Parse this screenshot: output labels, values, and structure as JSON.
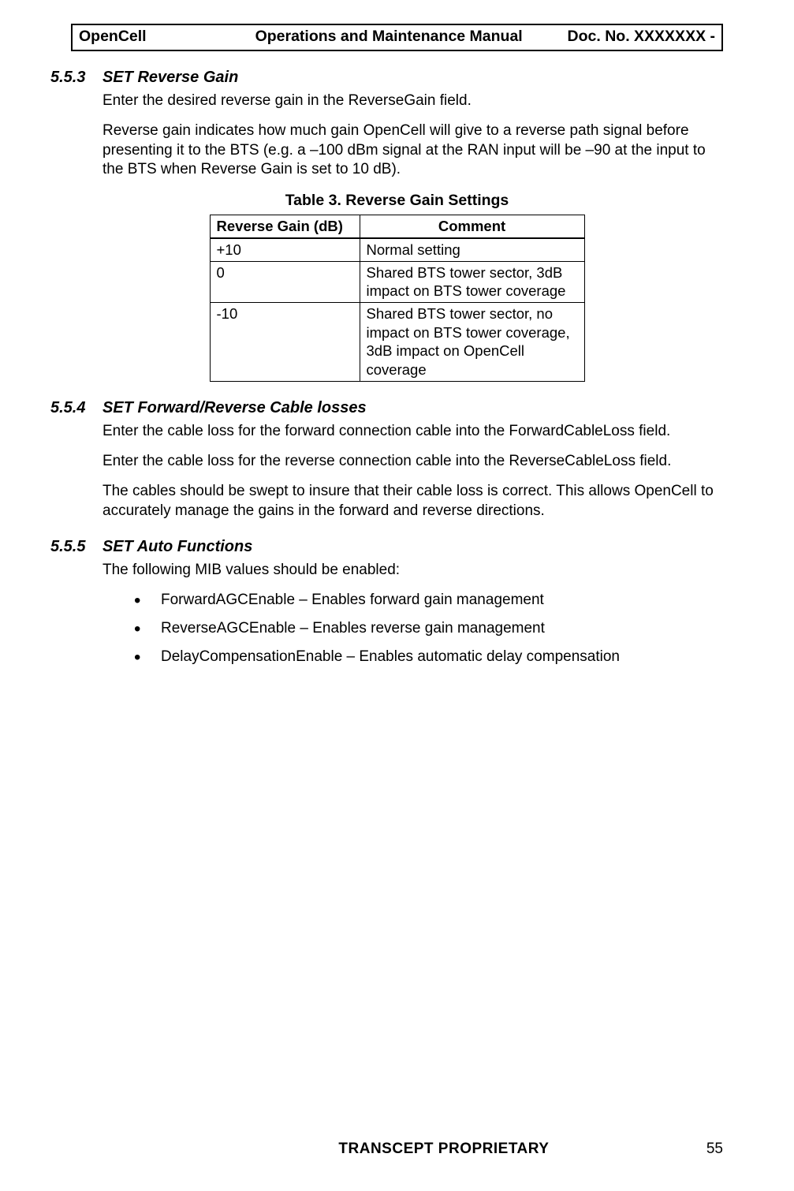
{
  "header": {
    "left": "OpenCell",
    "center": "Operations and Maintenance Manual",
    "right": "Doc. No.  XXXXXXX -"
  },
  "s553": {
    "num": "5.5.3",
    "title": "SET Reverse Gain",
    "p1": "Enter the desired reverse gain in the ReverseGain field.",
    "p2": "Reverse gain indicates how much gain OpenCell will give to a reverse path signal before presenting it to the BTS (e.g. a –100 dBm signal at the RAN input will be –90 at the input to the BTS when Reverse Gain is set to 10 dB)."
  },
  "table3": {
    "caption": "Table 3.  Reverse Gain Settings",
    "h1": "Reverse Gain (dB)",
    "h2": "Comment",
    "rows": [
      {
        "c1": "+10",
        "c2": "Normal setting"
      },
      {
        "c1": "0",
        "c2": "Shared BTS tower sector, 3dB impact on BTS tower coverage"
      },
      {
        "c1": "-10",
        "c2": "Shared BTS tower sector, no impact on BTS tower coverage, 3dB impact on OpenCell coverage"
      }
    ]
  },
  "s554": {
    "num": "5.5.4",
    "title": "SET Forward/Reverse Cable losses",
    "p1": "Enter the cable loss for the forward connection cable into the ForwardCableLoss field.",
    "p2": "Enter the cable loss for the reverse connection cable into the ReverseCableLoss field.",
    "p3": "The cables should be swept to insure that their cable loss is correct.  This allows OpenCell to accurately manage the gains in the forward and reverse directions."
  },
  "s555": {
    "num": "5.5.5",
    "title": "SET Auto Functions",
    "p1": "The following MIB values should be enabled:",
    "bullets": [
      "ForwardAGCEnable – Enables forward gain management",
      "ReverseAGCEnable – Enables reverse gain management",
      "DelayCompensationEnable – Enables automatic delay compensation"
    ]
  },
  "footer": {
    "center": "TRANSCEPT PROPRIETARY",
    "page": "55"
  }
}
